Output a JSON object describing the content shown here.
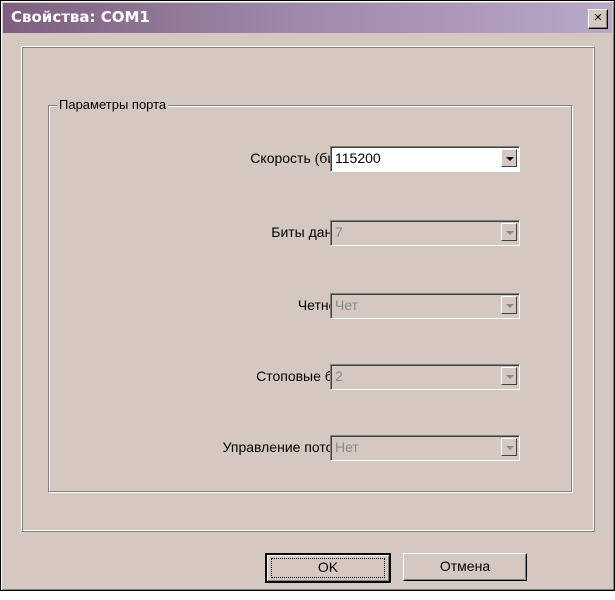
{
  "window": {
    "title": "Свойства: COM1",
    "close_label": "×"
  },
  "group": {
    "title": "Параметры порта"
  },
  "fields": [
    {
      "label": "Скорость (бит/с):",
      "value": "115200",
      "enabled": true
    },
    {
      "label": "Биты данных:",
      "value": "7",
      "enabled": false
    },
    {
      "label": "Четность:",
      "value": "Чет",
      "enabled": false
    },
    {
      "label": "Стоповые биты:",
      "value": "2",
      "enabled": false
    },
    {
      "label": "Управление потоком:",
      "value": "Нет",
      "enabled": false
    }
  ],
  "buttons": {
    "ok_label": "OK",
    "cancel_label": "Отмена"
  },
  "colors": {
    "dialog_bg": "#d4c8c0",
    "titlebar_start": "#7e5f7f",
    "titlebar_end": "#b9a8c7",
    "disabled_text": "#8a8a8a"
  }
}
